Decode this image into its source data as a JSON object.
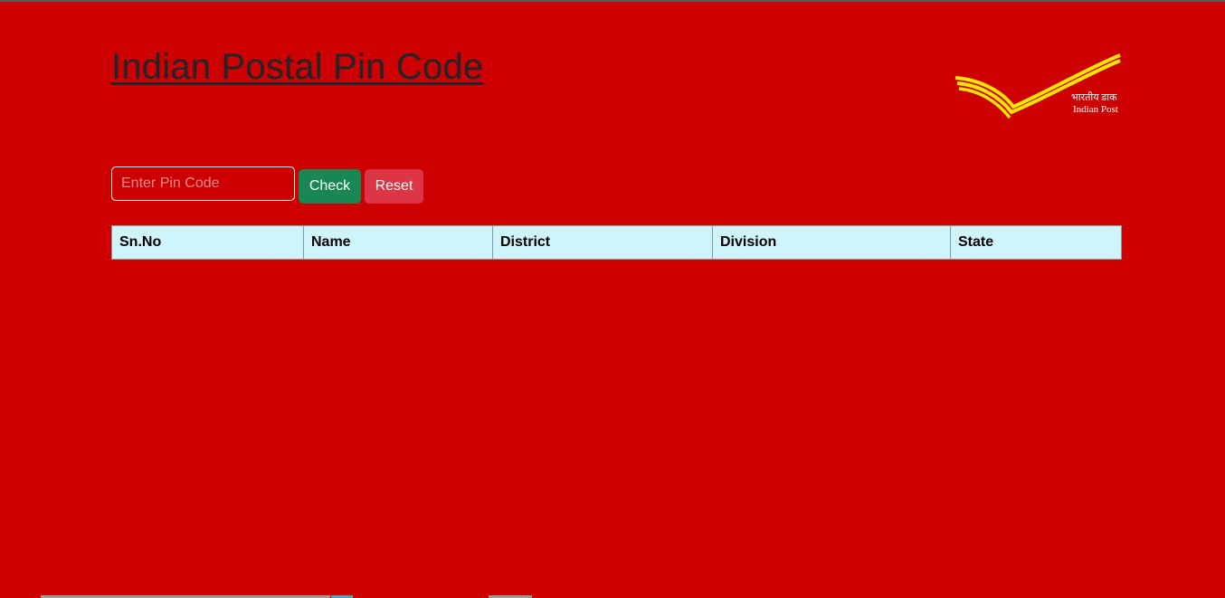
{
  "header": {
    "title": "Indian Postal Pin Code"
  },
  "logo": {
    "hindi_text": "भारतीय डाक",
    "english_text": "Indian Post",
    "icon": "india-post-logo-icon",
    "color": "#ffe600"
  },
  "search": {
    "placeholder": "Enter Pin Code",
    "value": "",
    "check_label": "Check",
    "reset_label": "Reset"
  },
  "table": {
    "columns": [
      "Sn.No",
      "Name",
      "District",
      "Division",
      "State"
    ],
    "rows": []
  },
  "colors": {
    "background": "#cc0000",
    "check_button": "#198754",
    "reset_button": "#dc3545",
    "table_header": "#cff4fc"
  }
}
